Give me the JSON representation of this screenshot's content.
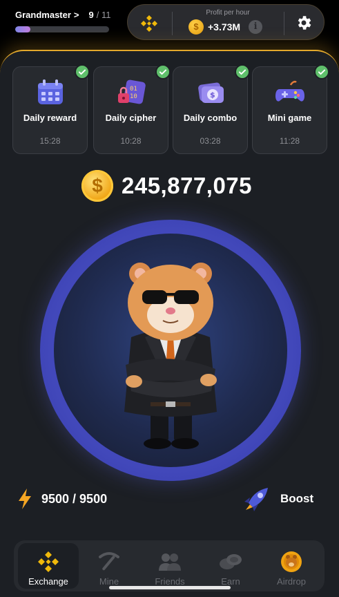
{
  "rank": {
    "name": "Grandmaster",
    "chevron": ">",
    "level": "9",
    "level_total": "/ 11",
    "progress": 0.16
  },
  "profit": {
    "label": "Profit per hour",
    "value": "+3.73M",
    "coin_symbol": "$",
    "info_symbol": "i"
  },
  "daily": [
    {
      "title": "Daily reward",
      "time": "15:28",
      "icon": "calendar-icon"
    },
    {
      "title": "Daily cipher",
      "time": "10:28",
      "icon": "cipher-icon"
    },
    {
      "title": "Daily combo",
      "time": "03:28",
      "icon": "combo-card-icon"
    },
    {
      "title": "Mini game",
      "time": "11:28",
      "icon": "gamepad-icon"
    }
  ],
  "balance": {
    "coin_symbol": "$",
    "value": "245,877,075"
  },
  "energy": {
    "value": "9500 / 9500"
  },
  "boost": {
    "label": "Boost"
  },
  "nav": [
    {
      "label": "Exchange",
      "icon": "exchange-icon",
      "active": true
    },
    {
      "label": "Mine",
      "icon": "pickaxe-icon",
      "active": false
    },
    {
      "label": "Friends",
      "icon": "friends-icon",
      "active": false
    },
    {
      "label": "Earn",
      "icon": "coins-icon",
      "active": false
    },
    {
      "label": "Airdrop",
      "icon": "airdrop-coin-icon",
      "active": false
    }
  ],
  "colors": {
    "accent": "#E3A82B",
    "panel": "#1C1F24",
    "card": "#272A2F",
    "check": "#5FBF6B",
    "tap_ring": "#4046B8"
  }
}
